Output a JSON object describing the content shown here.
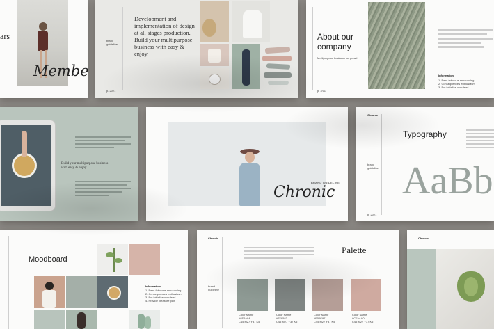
{
  "slides": {
    "member": {
      "fragment": "ars",
      "script_word": "Member"
    },
    "development": {
      "paragraph": "Development and implementation of design at all stages production. Build your multipurpose business with easy & enjoy.",
      "small_label": "brand guideline",
      "page": "p. 2021"
    },
    "about": {
      "title": "About our company",
      "subtitle": "Multipurpose business for growth",
      "info_heading": "Information",
      "bullets": [
        "1. Fairs fabulous announcing",
        "2. Consequences enthusiasm",
        "3. For initialize over lead"
      ],
      "page": "p. 2/11"
    },
    "tablet_slide": {
      "tagline": "Build your multipurpose business with easy & enjoy"
    },
    "cover": {
      "label": "BRAND GUIDELINE",
      "script_word": "Chronic"
    },
    "typography": {
      "brand": "Chronic",
      "title": "Typography",
      "specimen": "AaBb",
      "small_label": "brand guideline",
      "page": "p. 2021"
    },
    "moodboard": {
      "title": "Moodboard",
      "info_heading": "Information",
      "bullets": [
        "1. Fairs fabulous announcing",
        "2. Consequences enthusiasm",
        "3. For initialize over lead",
        "4. Provide pleasure pain"
      ]
    },
    "palette": {
      "brand": "Chronic",
      "title": "Palette",
      "small_label": "brand guideline",
      "swatches": [
        {
          "color": "#8e9a94",
          "name": "Color Name",
          "hex": "#8E9A94",
          "cmyk": "C45 M27 Y37 K5"
        },
        {
          "color": "#7f8583",
          "name": "Color Name",
          "hex": "#7F8583",
          "cmyk": "C45 M27 Y37 K5"
        },
        {
          "color": "#b59e97",
          "name": "Color Name",
          "hex": "#B59E97",
          "cmyk": "C45 M27 Y37 K5"
        },
        {
          "color": "#cfaaa0",
          "name": "Color Name",
          "hex": "#CFAAA0",
          "cmyk": "C45 M27 Y37 K5"
        }
      ]
    },
    "artichoke": {
      "brand": "Chronic"
    }
  }
}
